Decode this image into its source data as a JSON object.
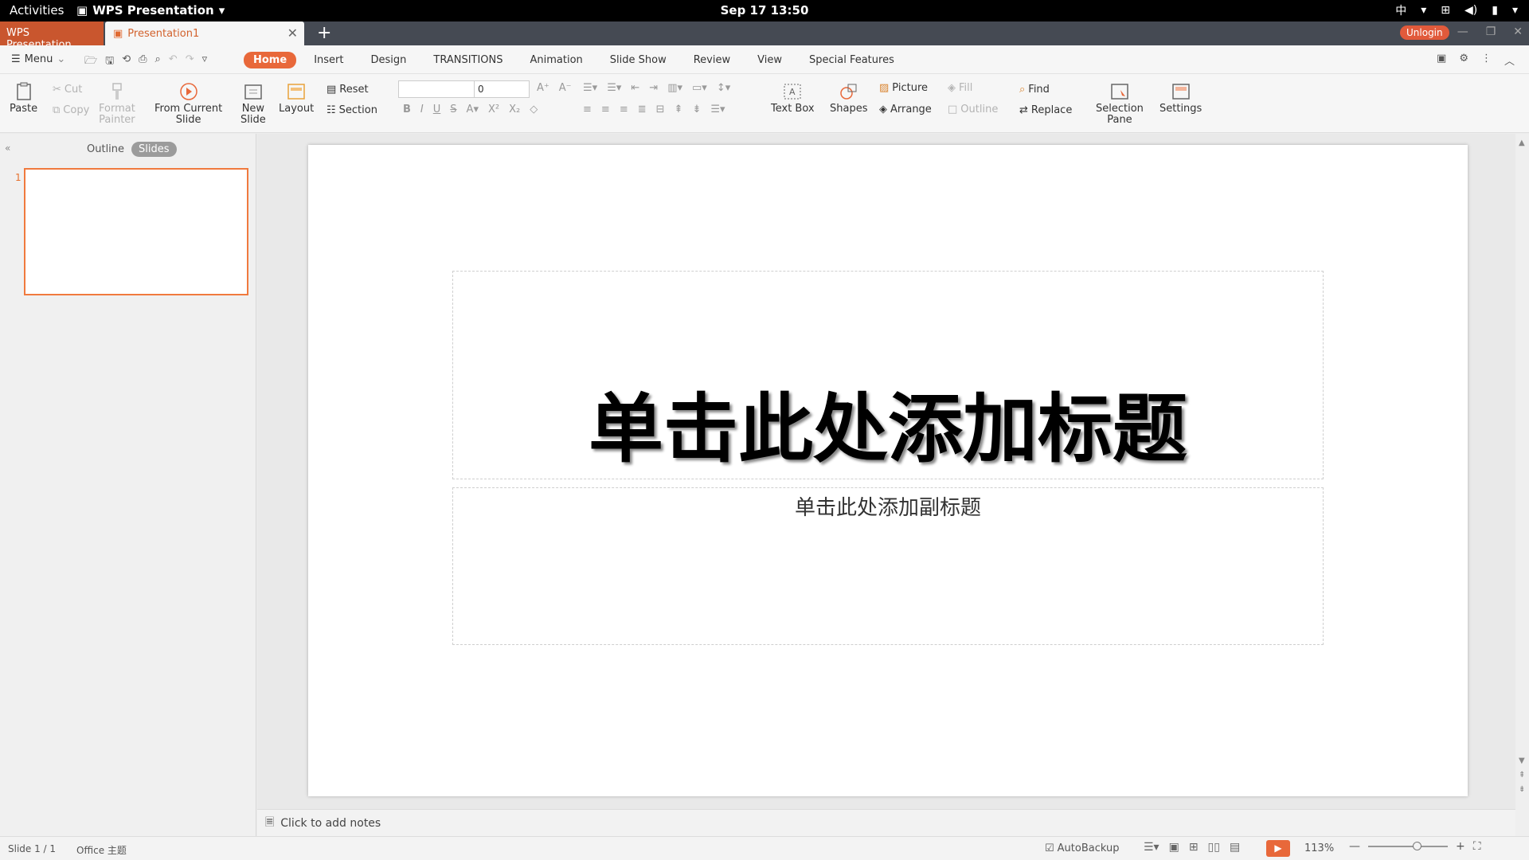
{
  "topbar": {
    "activities": "Activities",
    "app_name": "WPS Presentation",
    "clock": "Sep 17  13:50",
    "input_method": "中"
  },
  "tabbar": {
    "home_tab": "WPS Presentation",
    "doc_tab": "Presentation1",
    "add": "+",
    "unlogin": "Unlogin"
  },
  "menubar": {
    "menu_label": "Menu",
    "tabs": [
      "Home",
      "Insert",
      "Design",
      "TRANSITIONS",
      "Animation",
      "Slide Show",
      "Review",
      "View",
      "Special Features"
    ],
    "active_tab": "Home"
  },
  "ribbon": {
    "paste": "Paste",
    "cut": "Cut",
    "copy": "Copy",
    "format_painter_1": "Format",
    "format_painter_2": "Painter",
    "from_current_1": "From Current",
    "from_current_2": "Slide",
    "new_slide_1": "New",
    "new_slide_2": "Slide",
    "layout": "Layout",
    "reset": "Reset",
    "section": "Section",
    "font_size": "0",
    "text_box": "Text Box",
    "shapes": "Shapes",
    "picture": "Picture",
    "fill": "Fill",
    "arrange": "Arrange",
    "outline": "Outline",
    "find": "Find",
    "replace": "Replace",
    "selection_pane_1": "Selection",
    "selection_pane_2": "Pane",
    "settings": "Settings"
  },
  "panel": {
    "outline_tab": "Outline",
    "slides_tab": "Slides",
    "slide_number": "1"
  },
  "slide": {
    "title_placeholder": "单击此处添加标题",
    "subtitle_placeholder": "单击此处添加副标题"
  },
  "notes": {
    "placeholder": "Click to add notes"
  },
  "status": {
    "slide_info": "Slide 1 / 1",
    "theme": "Office 主题",
    "autobackup": "AutoBackup",
    "zoom": "113%"
  },
  "colors": {
    "accent": "#e8683a",
    "home_tab_bg": "#c9562e",
    "tabbar_bg": "#454a53"
  }
}
